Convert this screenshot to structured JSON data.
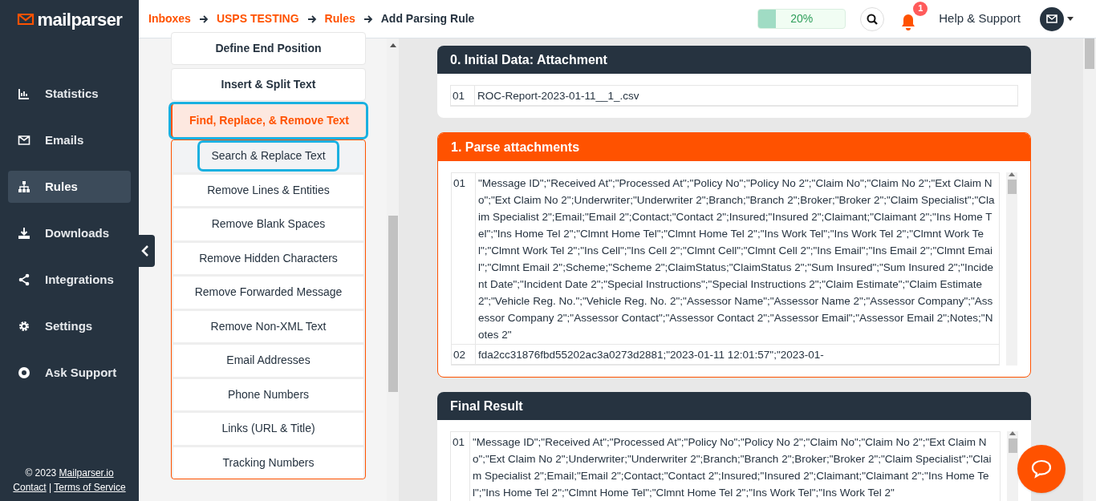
{
  "brand": {
    "logo_text": "mailparser"
  },
  "breadcrumb": [
    {
      "label": "Inboxes",
      "link": true
    },
    {
      "label": "USPS TESTING",
      "link": true
    },
    {
      "label": "Rules",
      "link": true
    },
    {
      "label": "Add Parsing Rule",
      "link": false
    }
  ],
  "header": {
    "progress": {
      "level": 0.2,
      "reading": "20%"
    },
    "notification_count": "1",
    "help": "Help & Support"
  },
  "sidebar": {
    "items": [
      {
        "label": "Statistics",
        "selected": false
      },
      {
        "label": "Emails",
        "selected": false
      },
      {
        "label": "Rules",
        "selected": true
      },
      {
        "label": "Downloads",
        "selected": false
      },
      {
        "label": "Integrations",
        "selected": false
      },
      {
        "label": "Settings",
        "selected": false
      },
      {
        "label": "Ask Support",
        "selected": false
      }
    ],
    "footer": {
      "copyright": "© 2023",
      "site": "Mailparser.io",
      "links": [
        "Contact",
        "Terms of Service"
      ],
      "separator": "|"
    }
  },
  "menu": [
    {
      "label": "Define End Position",
      "expanded": false
    },
    {
      "label": "Insert & Split Text",
      "expanded": false
    },
    {
      "label": "Find, Replace, & Remove Text",
      "expanded": true,
      "children": [
        {
          "label": "Search & Replace Text",
          "selected": true
        },
        {
          "label": "Remove Lines & Entities",
          "selected": false
        },
        {
          "label": "Remove Blank Spaces",
          "selected": false
        },
        {
          "label": "Remove Hidden Characters",
          "selected": false
        },
        {
          "label": "Remove Forwarded Message",
          "selected": false
        },
        {
          "label": "Remove Non-XML Text",
          "selected": false
        },
        {
          "label": "Email Addresses",
          "selected": false
        },
        {
          "label": "Phone Numbers",
          "selected": false
        },
        {
          "label": "Links (URL & Title)",
          "selected": false
        },
        {
          "label": "Tracking Numbers",
          "selected": false
        }
      ]
    }
  ],
  "panels": [
    {
      "title": "0. Initial Data: Attachment",
      "kind": "plain",
      "rows": [
        {
          "number": "01",
          "text": "ROC-Report-2023-01-11__1_.csv"
        }
      ]
    },
    {
      "title": "1. Parse attachments",
      "kind": "active",
      "rows": [
        {
          "number": "01",
          "text": "\"Message ID\";\"Received At\";\"Processed At\";\"Policy No\";\"Policy No 2\";\"Claim No\";\"Claim No 2\";\"Ext Claim No\";\"Ext Claim No 2\";Underwriter;\"Underwriter 2\";Branch;\"Branch 2\";Broker;\"Broker 2\";\"Claim Specialist\";\"Claim Specialist 2\";Email;\"Email 2\";Contact;\"Contact 2\";Insured;\"Insured 2\";Claimant;\"Claimant 2\";\"Ins Home Tel\";\"Ins Home Tel 2\";\"Clmnt Home Tel\";\"Clmnt Home Tel 2\";\"Ins Work Tel\";\"Ins Work Tel 2\";\"Clmnt Work Tel\";\"Clmnt Work Tel 2\";\"Ins Cell\";\"Ins Cell 2\";\"Clmnt Cell\";\"Clmnt Cell 2\";\"Ins Email\";\"Ins Email 2\";\"Clmnt Email\";\"Clmnt Email 2\";Scheme;\"Scheme 2\";ClaimStatus;\"ClaimStatus 2\";\"Sum Insured\";\"Sum Insured 2\";\"Incident Date\";\"Incident Date 2\";\"Special Instructions\";\"Special Instructions 2\";\"Claim Estimate\";\"Claim Estimate 2\";\"Vehicle Reg. No.\";\"Vehicle Reg. No. 2\";\"Assessor Name\";\"Assessor Name 2\";\"Assessor Company\";\"Assessor Company 2\";\"Assessor Contact\";\"Assessor Contact 2\";\"Assessor Email\";\"Assessor Email 2\";Notes;\"Notes 2\""
        },
        {
          "number": "02",
          "text": "fda2cc31876fbd55202ac3a0273d2881;\"2023-01-11 12:01:57\";\"2023-01-"
        }
      ]
    },
    {
      "title": "Final Result",
      "kind": "plain",
      "rows": [
        {
          "number": "01",
          "text": "\"Message ID\";\"Received At\";\"Processed At\";\"Policy No\";\"Policy No 2\";\"Claim No\";\"Claim No 2\";\"Ext Claim No\";\"Ext Claim No 2\";Underwriter;\"Underwriter 2\";Branch;\"Branch 2\";Broker;\"Broker 2\";\"Claim Specialist\";\"Claim Specialist 2\";Email;\"Email 2\";Contact;\"Contact 2\";Insured;\"Insured 2\";Claimant;\"Claimant 2\";\"Ins Home Tel\";\"Ins Home Tel 2\";\"Clmnt Home Tel\";\"Clmnt Home Tel 2\";\"Ins Work Tel\";\"Ins Work Tel 2\""
        }
      ]
    }
  ]
}
